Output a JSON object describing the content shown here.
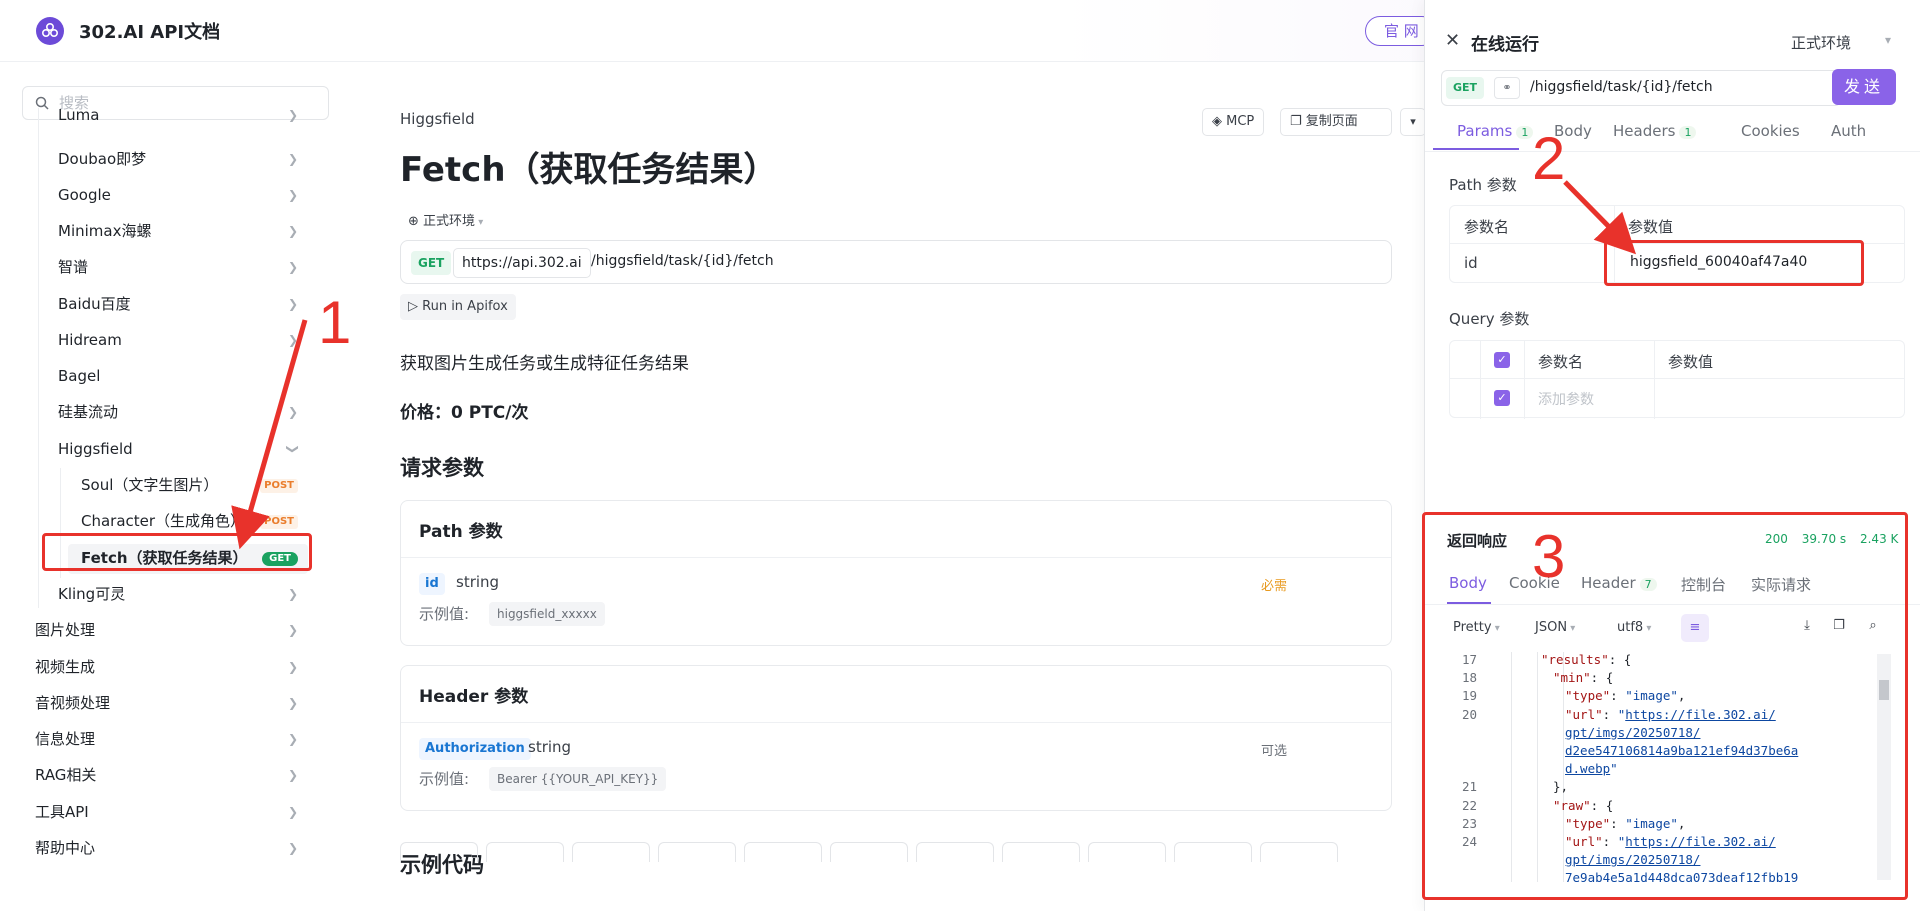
{
  "header": {
    "brand": "302.AI API文档",
    "official_btn": "官 网"
  },
  "sidebar": {
    "search_placeholder": "搜索",
    "items": [
      {
        "label": "Luma"
      },
      {
        "label": "Doubao即梦"
      },
      {
        "label": "Google"
      },
      {
        "label": "Minimax海螺"
      },
      {
        "label": "智谱"
      },
      {
        "label": "Baidu百度"
      },
      {
        "label": "Hidream"
      },
      {
        "label": "Bagel"
      },
      {
        "label": "硅基流动"
      },
      {
        "label": "Higgsfield"
      },
      {
        "label": "Soul（文字生图片）",
        "method": "POST"
      },
      {
        "label": "Character（生成角色）",
        "method": "POST"
      },
      {
        "label": "Fetch（获取任务结果）",
        "method": "GET"
      },
      {
        "label": "Kling可灵"
      },
      {
        "label": "图片处理"
      },
      {
        "label": "视频生成"
      },
      {
        "label": "音视频处理"
      },
      {
        "label": "信息处理"
      },
      {
        "label": "RAG相关"
      },
      {
        "label": "工具API"
      },
      {
        "label": "帮助中心"
      }
    ]
  },
  "main": {
    "breadcrumb": "Higgsfield",
    "mcp_btn": "MCP",
    "copy_btn": "复制页面",
    "title": "Fetch（获取任务结果）",
    "env": "正式环境",
    "method": "GET",
    "host": "https://api.302.ai",
    "path": "/higgsfield/task/{id}/fetch",
    "run_btn": "Run in Apifox",
    "description": "获取图片生成任务或生成特征任务结果",
    "price": "价格：0 PTC/次",
    "request_params_heading": "请求参数",
    "path_params": {
      "title": "Path 参数",
      "name": "id",
      "type": "string",
      "required": "必需",
      "example_label": "示例值:",
      "example_value": "higgsfield_xxxxx"
    },
    "header_params": {
      "title": "Header 参数",
      "name": "Authorization",
      "type": "string",
      "optional": "可选",
      "example_label": "示例值:",
      "example_value": "Bearer {{YOUR_API_KEY}}"
    },
    "sample_code_heading": "示例代码"
  },
  "panel": {
    "title": "在线运行",
    "env": "正式环境",
    "method": "GET",
    "path": "/higgsfield/task/{id}/fetch",
    "send_btn": "发送",
    "tabs": [
      {
        "label": "Params",
        "count": "1"
      },
      {
        "label": "Body"
      },
      {
        "label": "Headers",
        "count": "1"
      },
      {
        "label": "Cookies"
      },
      {
        "label": "Auth"
      }
    ],
    "path_section": "Path 参数",
    "path_table": {
      "col_name": "参数名",
      "col_value": "参数值",
      "row_name": "id",
      "row_value": "higgsfield_60040af47a40"
    },
    "query_section": "Query 参数",
    "query_table": {
      "col_name": "参数名",
      "col_value": "参数值",
      "add_placeholder": "添加参数"
    },
    "response": {
      "title": "返回响应",
      "status": "200",
      "time": "39.70 s",
      "size": "2.43 K",
      "tabs": [
        {
          "label": "Body"
        },
        {
          "label": "Cookie"
        },
        {
          "label": "Header",
          "count": "7"
        },
        {
          "label": "控制台"
        },
        {
          "label": "实际请求"
        }
      ],
      "format": "Pretty",
      "type": "JSON",
      "encoding": "utf8",
      "code_lines": [
        {
          "n": "17",
          "indent": 4,
          "parts": [
            [
              "k",
              "\"results\""
            ],
            [
              "p",
              ": {"
            ]
          ]
        },
        {
          "n": "18",
          "indent": 5,
          "parts": [
            [
              "k",
              "\"min\""
            ],
            [
              "p",
              ": {"
            ]
          ]
        },
        {
          "n": "19",
          "indent": 6,
          "parts": [
            [
              "k",
              "\"type\""
            ],
            [
              "p",
              ": "
            ],
            [
              "s",
              "\"image\""
            ],
            [
              "p",
              ","
            ]
          ]
        },
        {
          "n": "20",
          "indent": 6,
          "parts": [
            [
              "k",
              "\"url\""
            ],
            [
              "p",
              ": "
            ],
            [
              "s",
              "\""
            ],
            [
              "u",
              "https://file.302.ai/"
            ]
          ]
        },
        {
          "n": "",
          "indent": 6,
          "parts": [
            [
              "u",
              "gpt/imgs/20250718/"
            ]
          ]
        },
        {
          "n": "",
          "indent": 6,
          "parts": [
            [
              "u",
              "d2ee547106814a9ba121ef94d37be6a"
            ]
          ]
        },
        {
          "n": "",
          "indent": 6,
          "parts": [
            [
              "u",
              "d.webp"
            ],
            [
              "s",
              "\""
            ]
          ]
        },
        {
          "n": "21",
          "indent": 5,
          "parts": [
            [
              "p",
              "},"
            ]
          ]
        },
        {
          "n": "22",
          "indent": 5,
          "parts": [
            [
              "k",
              "\"raw\""
            ],
            [
              "p",
              ": {"
            ]
          ]
        },
        {
          "n": "23",
          "indent": 6,
          "parts": [
            [
              "k",
              "\"type\""
            ],
            [
              "p",
              ": "
            ],
            [
              "s",
              "\"image\""
            ],
            [
              "p",
              ","
            ]
          ]
        },
        {
          "n": "24",
          "indent": 6,
          "parts": [
            [
              "k",
              "\"url\""
            ],
            [
              "p",
              ": "
            ],
            [
              "s",
              "\""
            ],
            [
              "u",
              "https://file.302.ai/"
            ]
          ]
        },
        {
          "n": "",
          "indent": 6,
          "parts": [
            [
              "u",
              "gpt/imgs/20250718/"
            ]
          ]
        },
        {
          "n": "",
          "indent": 6,
          "parts": [
            [
              "u",
              "7e9ab4e5a1d448dca073deaf12fbb19"
            ]
          ]
        }
      ]
    }
  },
  "annotations": {
    "n1": "1",
    "n2": "2",
    "n3": "3",
    "color": "#e8322b"
  }
}
